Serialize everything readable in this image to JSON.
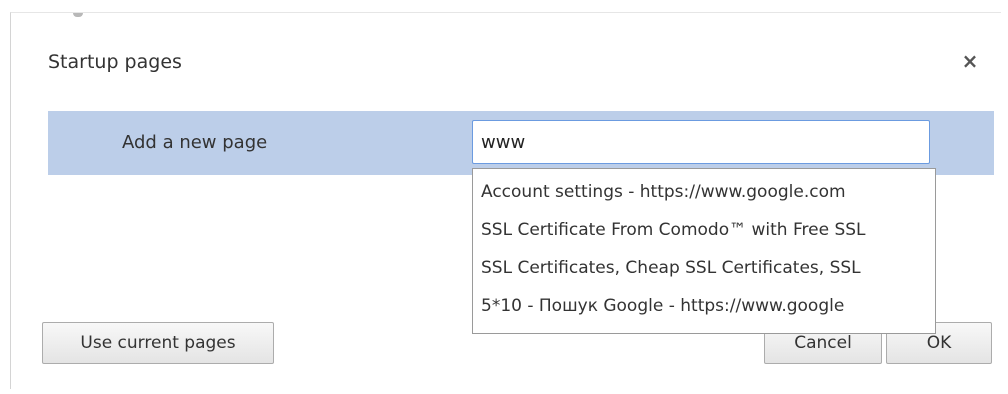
{
  "dialog": {
    "title": "Startup pages",
    "close_label": "×"
  },
  "add_page": {
    "label": "Add a new page",
    "input_value": "www"
  },
  "suggestions": [
    "Account settings - https://www.google.com",
    "SSL Certificate From Comodo™ with Free SSL",
    "SSL Certificates, Cheap SSL Certificates, SSL",
    "5*10 - Пошук Google - https://www.google"
  ],
  "buttons": {
    "use_current": "Use current pages",
    "cancel": "Cancel",
    "ok": "OK"
  }
}
